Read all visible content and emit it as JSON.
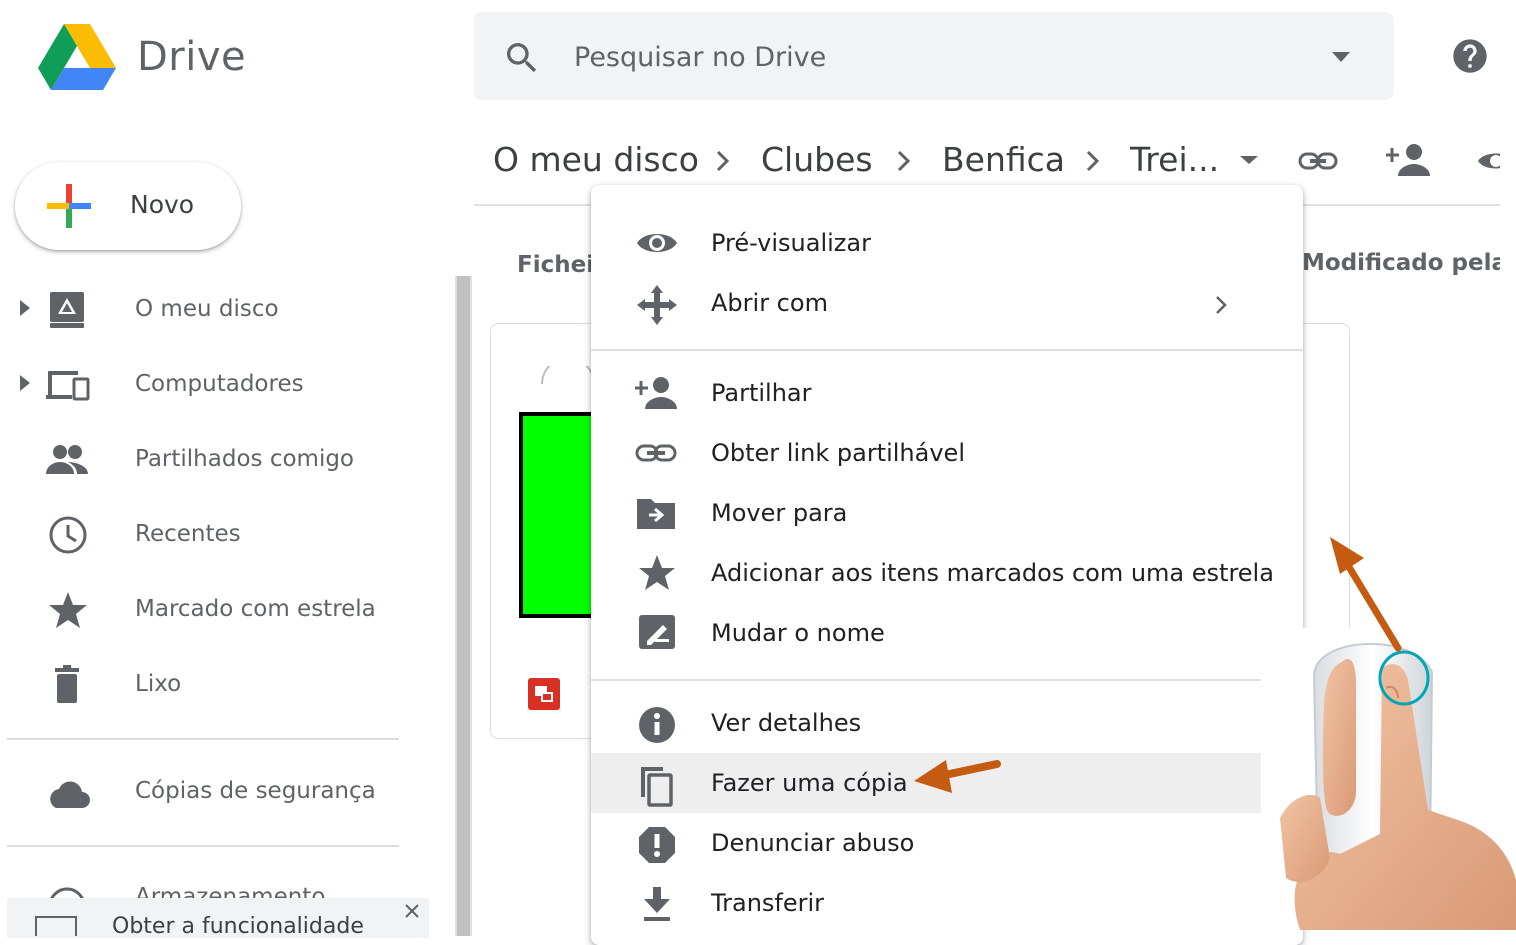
{
  "app": {
    "name": "Drive",
    "logo": "google-drive-logo"
  },
  "search": {
    "placeholder": "Pesquisar no Drive",
    "icon": "search-icon",
    "options_icon": "arrow-drop-down-icon"
  },
  "header": {
    "help_icon": "help-icon"
  },
  "new_button": {
    "label": "Novo",
    "icon": "colored-plus-icon"
  },
  "sidebar": {
    "items": [
      {
        "label": "O meu disco",
        "icon": "my-drive-icon",
        "expandable": true
      },
      {
        "label": "Computadores",
        "icon": "computers-icon",
        "expandable": true
      },
      {
        "label": "Partilhados comigo",
        "icon": "people-icon"
      },
      {
        "label": "Recentes",
        "icon": "clock-icon"
      },
      {
        "label": "Marcado com estrela",
        "icon": "star-icon"
      },
      {
        "label": "Lixo",
        "icon": "trash-icon"
      },
      {
        "label": "Cópias de segurança",
        "icon": "cloud-icon"
      },
      {
        "label": "Armazenamento",
        "icon": "storage-icon"
      }
    ]
  },
  "notification": {
    "text": "Obter a funcionalidade",
    "close_icon": "close-icon"
  },
  "breadcrumb": {
    "items": [
      "O meu disco",
      "Clubes",
      "Benfica",
      "Trei..."
    ],
    "actions": [
      "link-icon",
      "add-person-icon",
      "eye-icon"
    ]
  },
  "content": {
    "files_header": "Ficheir",
    "modified_header": "Modificado pela úl"
  },
  "context_menu": {
    "groups": [
      [
        {
          "label": "Pré-visualizar",
          "icon": "eye-icon"
        },
        {
          "label": "Abrir com",
          "icon": "open-with-icon",
          "submenu": true
        }
      ],
      [
        {
          "label": "Partilhar",
          "icon": "person-add-icon"
        },
        {
          "label": "Obter link partilhável",
          "icon": "link-icon"
        },
        {
          "label": "Mover para",
          "icon": "move-to-folder-icon"
        },
        {
          "label": "Adicionar aos itens marcados com uma estrela",
          "icon": "star-icon"
        },
        {
          "label": "Mudar o nome",
          "icon": "rename-icon"
        }
      ],
      [
        {
          "label": "Ver detalhes",
          "icon": "info-icon"
        },
        {
          "label": "Fazer uma cópia",
          "icon": "copy-icon",
          "highlighted": true
        },
        {
          "label": "Denunciar abuso",
          "icon": "report-icon"
        },
        {
          "label": "Transferir",
          "icon": "download-icon"
        }
      ]
    ]
  },
  "colors": {
    "accent_arrow": "#c55a11",
    "green_thumbnail": "#00ff00",
    "menu_highlight": "#eeeeee",
    "text_primary": "#202124",
    "text_secondary": "#5f6368"
  }
}
